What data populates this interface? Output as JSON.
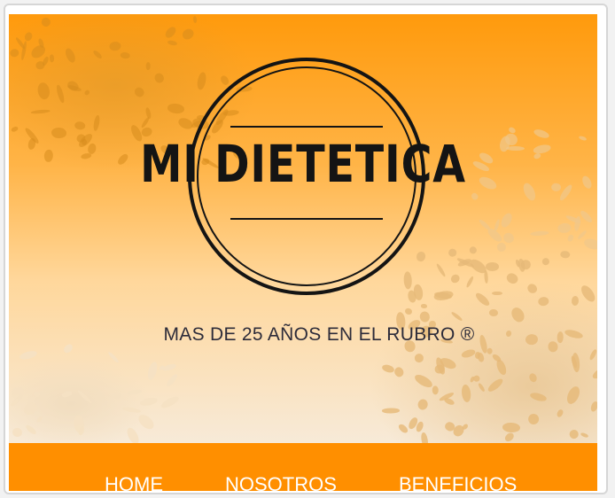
{
  "logo": {
    "brand_name": "MI DIETETICA",
    "ink_color": "#141414"
  },
  "hero": {
    "tagline": "MAS DE 25 AÑOS EN EL RUBRO ®",
    "background_color": "#ff9a0c"
  },
  "nav": {
    "background_color": "#ff8f00",
    "items": [
      {
        "label": "HOME"
      },
      {
        "label": "NOSOTROS"
      },
      {
        "label": "BENEFICIOS"
      }
    ]
  }
}
